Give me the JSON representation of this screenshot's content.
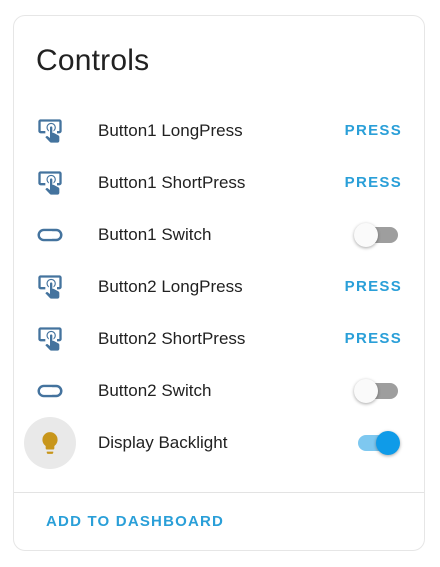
{
  "card": {
    "title": "Controls",
    "footer_label": "ADD TO DASHBOARD"
  },
  "colors": {
    "icon": "#44739e",
    "accent": "#2a9fd8",
    "toggle_on": "#0f9be8",
    "bulb": "#c8961b"
  },
  "entities": [
    {
      "icon": "gesture-tap-button-icon",
      "label": "Button1 LongPress",
      "control": "button",
      "action_label": "PRESS"
    },
    {
      "icon": "gesture-tap-button-icon",
      "label": "Button1 ShortPress",
      "control": "button",
      "action_label": "PRESS"
    },
    {
      "icon": "toggle-switch-icon",
      "label": "Button1 Switch",
      "control": "toggle",
      "state": "off"
    },
    {
      "icon": "gesture-tap-button-icon",
      "label": "Button2 LongPress",
      "control": "button",
      "action_label": "PRESS"
    },
    {
      "icon": "gesture-tap-button-icon",
      "label": "Button2 ShortPress",
      "control": "button",
      "action_label": "PRESS"
    },
    {
      "icon": "toggle-switch-icon",
      "label": "Button2 Switch",
      "control": "toggle",
      "state": "off"
    },
    {
      "icon": "lightbulb-icon",
      "label": "Display Backlight",
      "control": "toggle",
      "state": "on"
    }
  ]
}
